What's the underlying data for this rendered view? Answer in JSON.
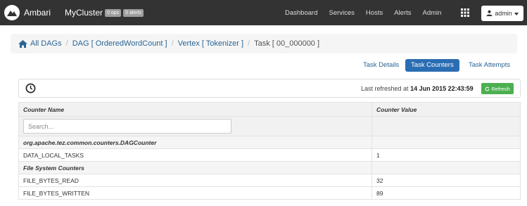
{
  "navbar": {
    "brand": "Ambari",
    "cluster": "MyCluster",
    "ops_badge": "0 ops",
    "alerts_badge": "0 alerts",
    "links": [
      "Dashboard",
      "Services",
      "Hosts",
      "Alerts",
      "Admin"
    ],
    "user_menu": "admin"
  },
  "breadcrumb": {
    "items": [
      "All DAGs",
      "DAG [ OrderedWordCount ]",
      "Vertex [ Tokenizer ]"
    ],
    "active": "Task [ 00_000000 ]"
  },
  "tabs": [
    "Task Details",
    "Task Counters",
    "Task Attempts"
  ],
  "active_tab": "Task Counters",
  "refresh_bar": {
    "prefix": "Last refreshed at",
    "timestamp": "14 Jun 2015 22:43:59",
    "button_label": "Refresh"
  },
  "table": {
    "columns": [
      "Counter Name",
      "Counter Value"
    ],
    "search_placeholder": "Search...",
    "rows": [
      {
        "type": "group",
        "name": "org.apache.tez.common.counters.DAGCounter",
        "value": ""
      },
      {
        "type": "data",
        "name": "DATA_LOCAL_TASKS",
        "value": "1"
      },
      {
        "type": "group",
        "name": "File System Counters",
        "value": ""
      },
      {
        "type": "data",
        "name": "FILE_BYTES_READ",
        "value": "32"
      },
      {
        "type": "data",
        "name": "FILE_BYTES_WRITTEN",
        "value": "89"
      }
    ]
  },
  "colors": {
    "navbar": "#333333",
    "link": "#2a6496",
    "active_tab": "#2a6db3",
    "refresh_button": "#4caf50"
  },
  "icons": [
    "ambari-logo-icon",
    "home-icon",
    "grid-icon",
    "user-icon",
    "caret-down-icon",
    "clock-icon",
    "refresh-icon"
  ]
}
